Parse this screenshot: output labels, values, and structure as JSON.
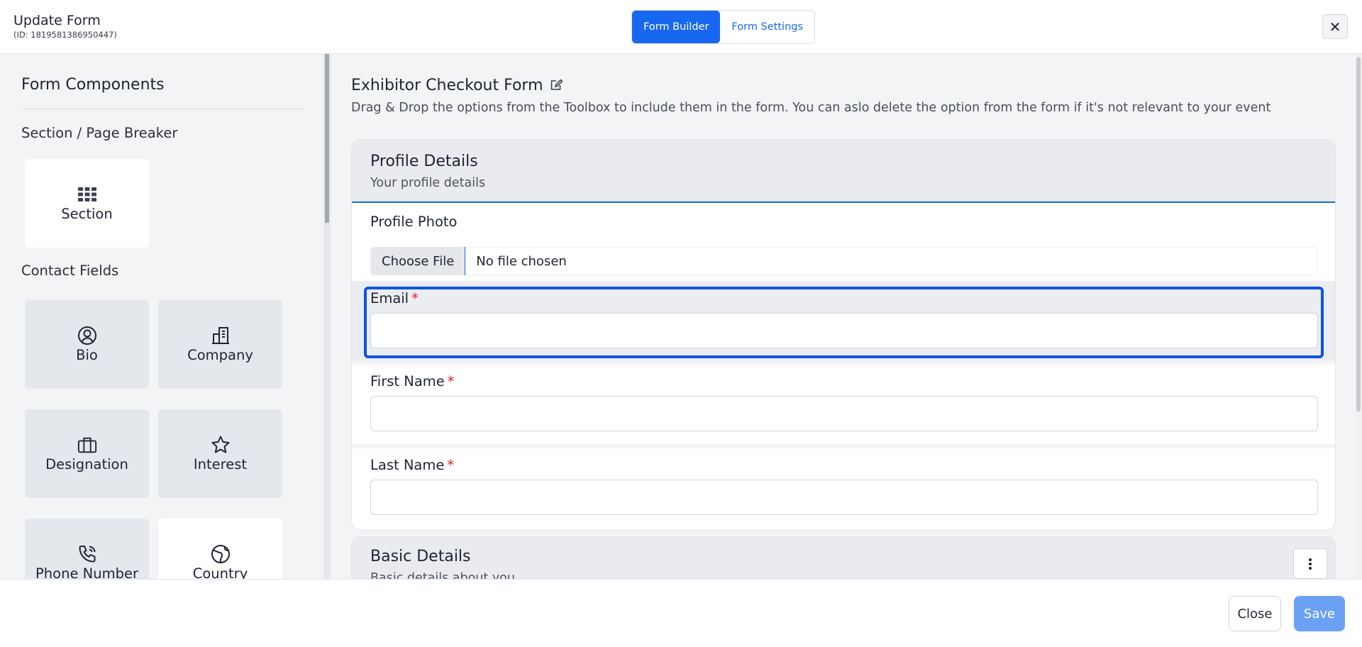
{
  "header": {
    "title": "Update Form",
    "id_text": "(ID: 1819581386950447)",
    "tabs": [
      {
        "label": "Form Builder",
        "active": true
      },
      {
        "label": "Form Settings",
        "active": false
      }
    ],
    "close_icon": "close-icon"
  },
  "sidebar": {
    "title": "Form Components",
    "groups": [
      {
        "label": "Section / Page Breaker"
      },
      {
        "label": "Contact Fields"
      }
    ],
    "cards": [
      {
        "label": "Section",
        "icon": "grid-icon"
      },
      {
        "label": "Bio",
        "icon": "user-circle-icon"
      },
      {
        "label": "Company",
        "icon": "building-icon"
      },
      {
        "label": "Designation",
        "icon": "briefcase-icon"
      },
      {
        "label": "Interest",
        "icon": "star-icon"
      },
      {
        "label": "Phone Number",
        "icon": "phone-icon"
      },
      {
        "label": "Country",
        "icon": "globe-icon"
      }
    ]
  },
  "main": {
    "form_title": "Exhibitor Checkout Form",
    "description": "Drag & Drop the options from the Toolbox to include them in the form. You can aslo delete the option from the form if it's not relevant to your event",
    "sections": [
      {
        "title": "Profile Details",
        "subtitle": "Your profile details",
        "fields": [
          {
            "label": "Profile Photo",
            "button": "Choose File",
            "status": "No file chosen"
          },
          {
            "label": "Email",
            "required": "*",
            "value": ""
          },
          {
            "label": "First Name",
            "required": "*",
            "value": ""
          },
          {
            "label": "Last Name",
            "required": "*",
            "value": ""
          }
        ]
      },
      {
        "title": "Basic Details",
        "subtitle": "Basic details about you"
      }
    ]
  },
  "footer": {
    "close_label": "Close",
    "save_label": "Save"
  },
  "colors": {
    "primary": "#1767ef",
    "required": "#e11d2a",
    "save_disabled": "#6aa1f5"
  }
}
